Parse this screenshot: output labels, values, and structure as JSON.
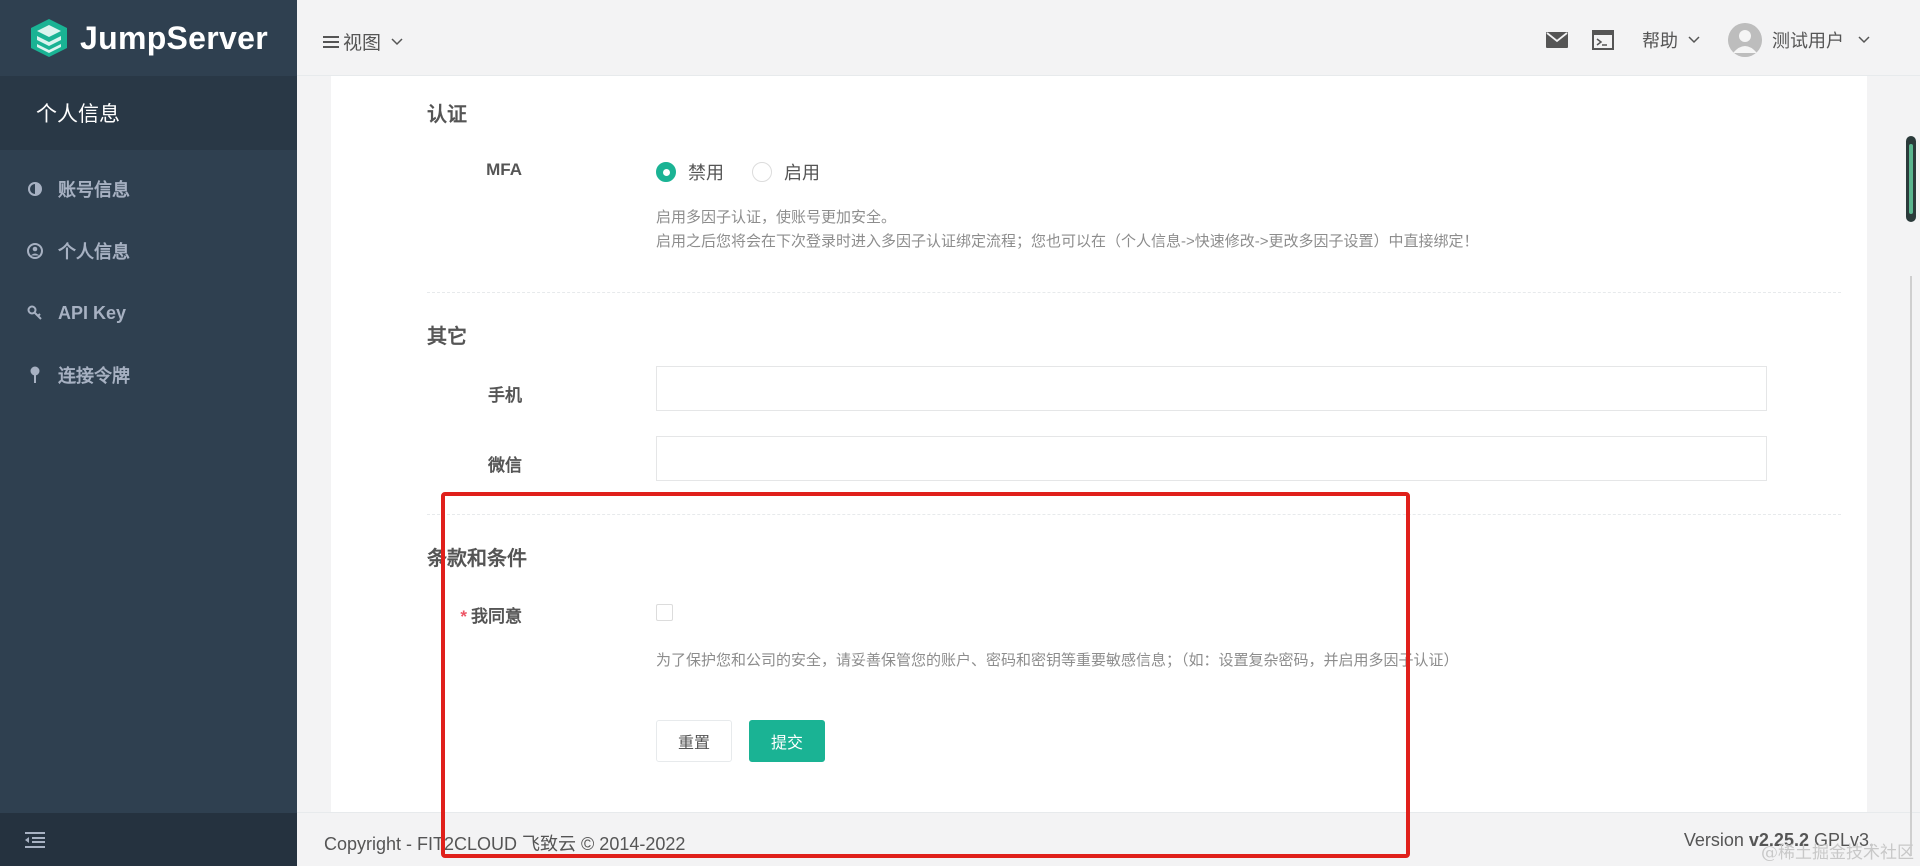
{
  "app": {
    "logo_text": "JumpServer",
    "colors": {
      "sidebar_bg": "#2f4050",
      "accent": "#1ab394",
      "required": "#ed5565",
      "annotation": "#e0201b"
    }
  },
  "sidebar": {
    "section_title": "个人信息",
    "items": [
      {
        "label": "账号信息",
        "icon": "half-circle-icon"
      },
      {
        "label": "个人信息",
        "icon": "user-circle-icon"
      },
      {
        "label": "API Key",
        "icon": "key-icon"
      },
      {
        "label": "连接令牌",
        "icon": "pin-icon"
      }
    ],
    "footer_icon": "collapse-menu-icon"
  },
  "topbar": {
    "view_label": "视图",
    "help_label": "帮助",
    "user_name": "测试用户",
    "icons": [
      "mail-icon",
      "terminal-icon",
      "avatar-icon"
    ]
  },
  "auth_section": {
    "title": "认证",
    "mfa_label": "MFA",
    "options": [
      {
        "label": "禁用",
        "checked": true
      },
      {
        "label": "启用",
        "checked": false
      }
    ],
    "help_line1": "启用多因子认证，使账号更加安全。",
    "help_line2": "启用之后您将会在下次登录时进入多因子认证绑定流程；您也可以在（个人信息->快速修改->更改多因子设置）中直接绑定！"
  },
  "other_section": {
    "title": "其它",
    "phone_label": "手机",
    "phone_value": "",
    "wechat_label": "微信",
    "wechat_value": ""
  },
  "terms_section": {
    "title": "条款和条件",
    "agree_star": "*",
    "agree_label": "我同意",
    "agree_checked": false,
    "help": "为了保护您和公司的安全，请妥善保管您的账户、密码和密钥等重要敏感信息；（如：设置复杂密码，并启用多因子认证）"
  },
  "buttons": {
    "reset": "重置",
    "submit": "提交"
  },
  "footer": {
    "copyright": "Copyright - FIT2CLOUD 飞致云 © 2014-2022",
    "version_prefix": "Version ",
    "version_number": "v2.25.2",
    "license": " GPLv3."
  },
  "watermark": "@稀土掘金技术社区"
}
